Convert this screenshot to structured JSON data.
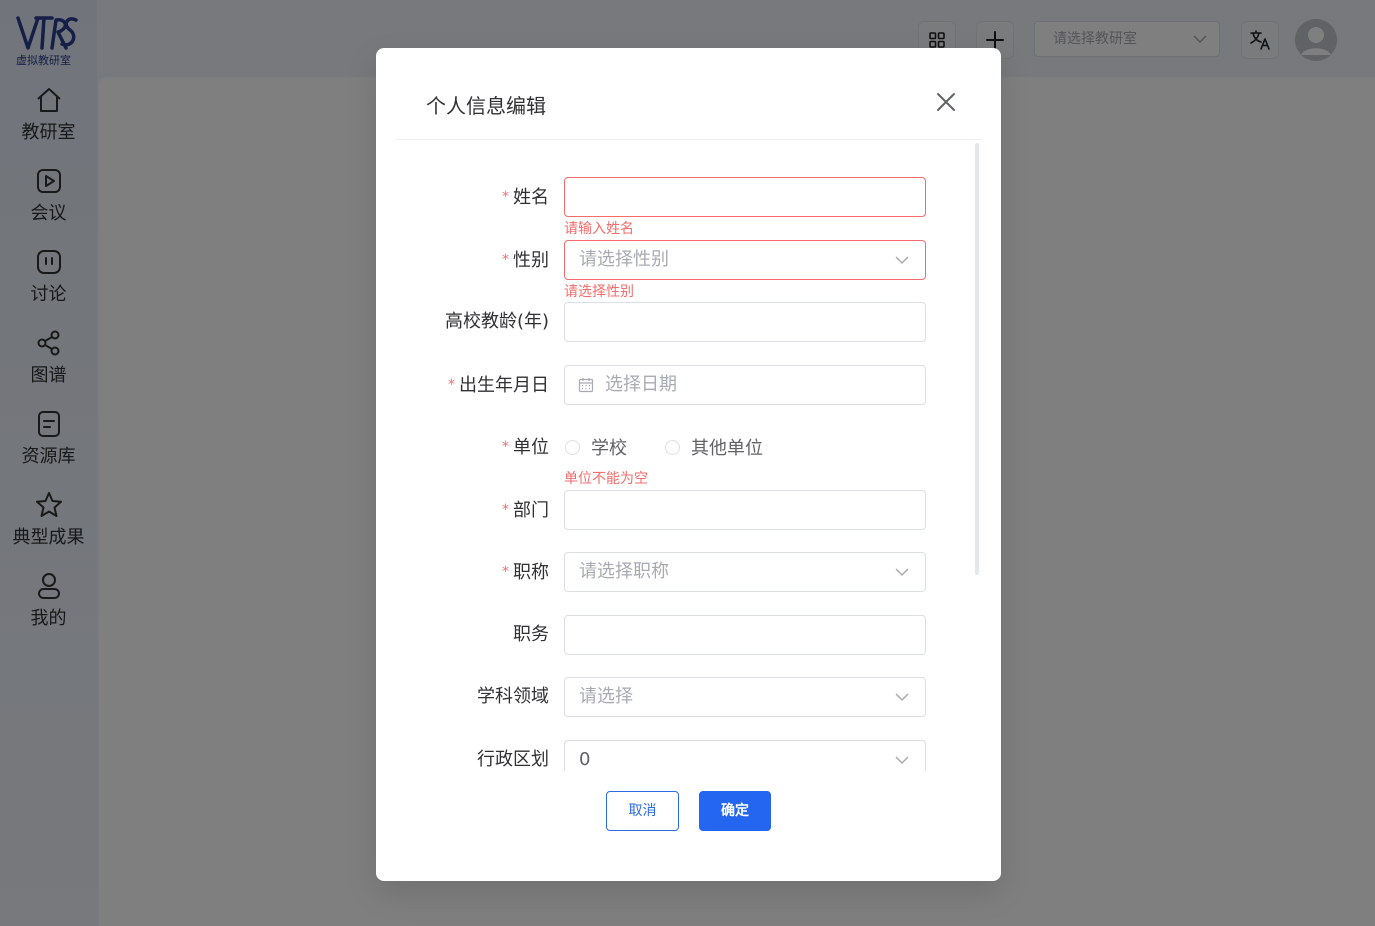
{
  "app": {
    "logo_text": "虚拟教研室",
    "logo_mark": "VTRS"
  },
  "sidebar": {
    "items": [
      {
        "label": "教研室",
        "icon": "home-icon"
      },
      {
        "label": "会议",
        "icon": "video-icon"
      },
      {
        "label": "讨论",
        "icon": "chat-icon"
      },
      {
        "label": "图谱",
        "icon": "share-icon"
      },
      {
        "label": "资源库",
        "icon": "document-icon"
      },
      {
        "label": "典型成果",
        "icon": "star-icon"
      },
      {
        "label": "我的",
        "icon": "user-icon"
      }
    ]
  },
  "topbar": {
    "room_select_placeholder": "请选择教研室",
    "icons": [
      "grid-icon",
      "plus-icon",
      "translate-icon",
      "avatar"
    ]
  },
  "dialog": {
    "title": "个人信息编辑",
    "fields": {
      "name": {
        "label": "姓名",
        "required": true,
        "value": "",
        "error": "请输入姓名"
      },
      "gender": {
        "label": "性别",
        "required": true,
        "placeholder": "请选择性别",
        "error": "请选择性别"
      },
      "teaching_years": {
        "label": "高校教龄(年)",
        "required": false,
        "value": ""
      },
      "birthday": {
        "label": "出生年月日",
        "required": true,
        "placeholder": "选择日期"
      },
      "unit": {
        "label": "单位",
        "required": true,
        "options": [
          "学校",
          "其他单位"
        ],
        "error": "单位不能为空"
      },
      "department": {
        "label": "部门",
        "required": true,
        "value": ""
      },
      "title": {
        "label": "职称",
        "required": true,
        "placeholder": "请选择职称"
      },
      "position": {
        "label": "职务",
        "required": false,
        "value": ""
      },
      "discipline": {
        "label": "学科领域",
        "required": false,
        "placeholder": "请选择"
      },
      "region": {
        "label": "行政区划",
        "required": false,
        "value": "0"
      }
    },
    "required_mark": "*",
    "cancel_label": "取消",
    "confirm_label": "确定"
  },
  "colors": {
    "primary": "#2466f0",
    "error": "#f56c6c",
    "border": "#dcdfe6",
    "placeholder": "#a8abb2"
  }
}
